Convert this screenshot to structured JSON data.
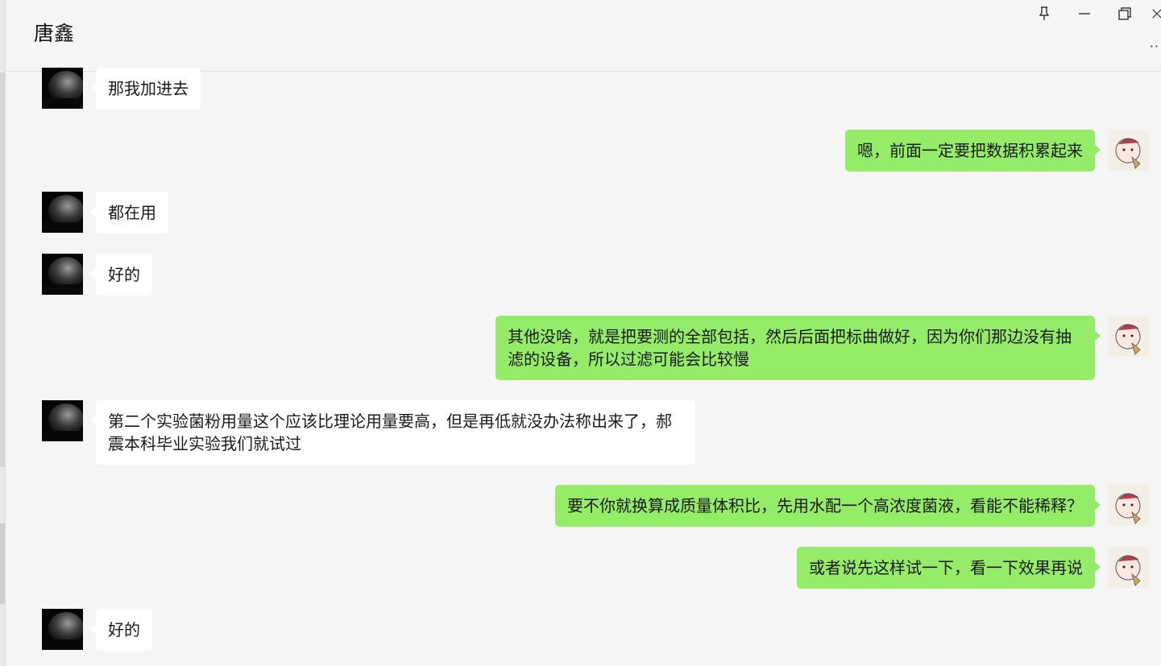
{
  "header": {
    "title": "唐鑫",
    "pin_icon": "pin-icon",
    "minimize_icon": "minimize-icon",
    "restore_icon": "restore-icon",
    "close_icon": "close-icon",
    "more_icon": "more-icon",
    "more_label": "··"
  },
  "messages": [
    {
      "side": "left",
      "text": "那我加进去"
    },
    {
      "side": "right",
      "text": "嗯，前面一定要把数据积累起来"
    },
    {
      "side": "left",
      "text": "都在用"
    },
    {
      "side": "left",
      "text": "好的"
    },
    {
      "side": "right",
      "text": "其他没啥，就是把要测的全部包括，然后后面把标曲做好，因为你们那边没有抽滤的设备，所以过滤可能会比较慢"
    },
    {
      "side": "left",
      "text": "第二个实验菌粉用量这个应该比理论用量要高，但是再低就没办法称出来了，郝震本科毕业实验我们就试过"
    },
    {
      "side": "right",
      "text": "要不你就换算成质量体积比，先用水配一个高浓度菌液，看能不能稀释？"
    },
    {
      "side": "right",
      "text": "或者说先这样试一下，看一下效果再说"
    },
    {
      "side": "left",
      "text": "好的"
    }
  ],
  "colors": {
    "background": "#f5f5f5",
    "sent_bubble": "#95ec69",
    "received_bubble": "#ffffff"
  }
}
